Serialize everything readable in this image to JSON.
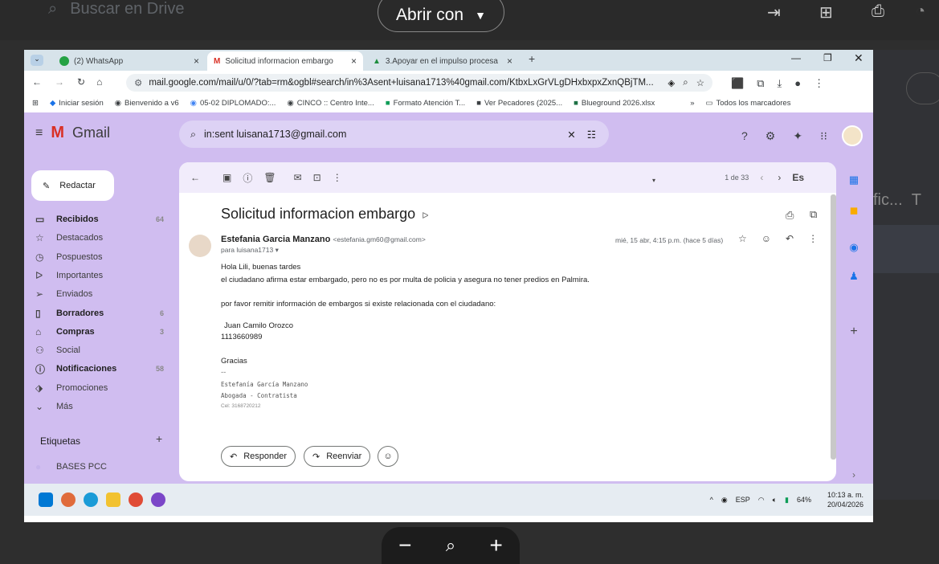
{
  "viewer": {
    "search_placeholder": "Buscar en Drive",
    "open_with": "Abrir con",
    "right_ghost": "fic...",
    "right_ghost2": "T",
    "zoom_out": "−",
    "zoom_in": "+"
  },
  "browser": {
    "tabs": [
      {
        "label": "(2) WhatsApp",
        "close": "×"
      },
      {
        "label": "Solicitud informacion embargo",
        "close": "×"
      },
      {
        "label": "3.Apoyar en el impulso procesa",
        "close": "×"
      }
    ],
    "new_tab": "+",
    "url": "mail.google.com/mail/u/0/?tab=rm&ogbl#search/in%3Asent+luisana1713%40gmail.com/KtbxLxGrVLgDHxbxpxZxnQBjTM...",
    "bookmarks": [
      "Iniciar sesión",
      "Bienvenido a v6",
      "05-02 DIPLOMADO:...",
      "CINCO :: Centro Inte...",
      "Formato Atención T...",
      "Ver Pecadores (2025...",
      "Blueground 2026.xlsx"
    ],
    "bookmarks_more": "»",
    "all_bookmarks": "Todos los marcadores"
  },
  "gmail": {
    "brand": "Gmail",
    "search_value": "in:sent luisana1713@gmail.com",
    "compose": "Redactar",
    "nav": [
      {
        "label": "Recibidos",
        "count": "64",
        "bold": true,
        "icon": "inbox-icon"
      },
      {
        "label": "Destacados",
        "count": "",
        "bold": false,
        "icon": "star-icon"
      },
      {
        "label": "Pospuestos",
        "count": "",
        "bold": false,
        "icon": "clock-icon"
      },
      {
        "label": "Importantes",
        "count": "",
        "bold": false,
        "icon": "important-icon"
      },
      {
        "label": "Enviados",
        "count": "",
        "bold": false,
        "icon": "send-icon"
      },
      {
        "label": "Borradores",
        "count": "6",
        "bold": true,
        "icon": "draft-icon"
      },
      {
        "label": "Compras",
        "count": "3",
        "bold": true,
        "icon": "bag-icon"
      },
      {
        "label": "Social",
        "count": "",
        "bold": false,
        "icon": "people-icon"
      },
      {
        "label": "Notificaciones",
        "count": "58",
        "bold": true,
        "icon": "info-icon"
      },
      {
        "label": "Promociones",
        "count": "",
        "bold": false,
        "icon": "tag-icon"
      },
      {
        "label": "Más",
        "count": "",
        "bold": false,
        "icon": "chevron-down-icon"
      }
    ],
    "labels_title": "Etiquetas",
    "labels": [
      "BASES PCC"
    ],
    "pager": "1 de 33",
    "lang": "Es",
    "email": {
      "subject": "Solicitud informacion embargo",
      "sender_name": "Estefania Garcia Manzano",
      "sender_email": "<estefania.gm60@gmail.com>",
      "to": "para luisana1713",
      "date": "mié, 15 abr, 4:15 p.m. (hace 5 días)",
      "lines": [
        "Hola Lili, buenas tardes",
        "el ciudadano afirma estar embargado, pero no es por multa de policia y asegura no tener predios en Palmira.",
        "por favor remitir información de embargos si existe relacionada con el ciudadano:",
        "Juan Camilo Orozco",
        "1113660989",
        "Gracias",
        "--"
      ],
      "sig": [
        "Estefanía García Manzano",
        "Abogada - Contratista",
        "Cel: 3168720212"
      ]
    },
    "reply": "Responder",
    "forward": "Reenviar"
  },
  "taskbar": {
    "lang": "ESP",
    "battery": "64%",
    "time": "10:13 a. m.",
    "date": "20/04/2026"
  },
  "colors": {
    "gmail_bg": "#d0bdf0",
    "tab_bar": "#d7e3ea",
    "viewer_bg": "#2e2e2e"
  }
}
